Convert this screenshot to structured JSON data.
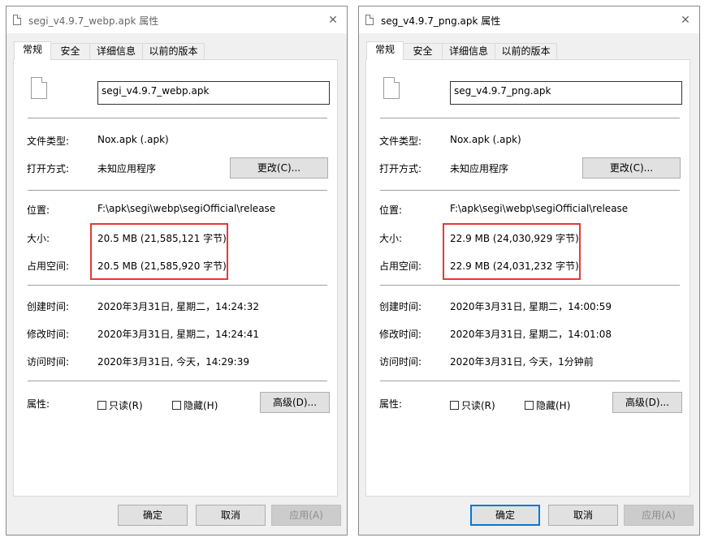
{
  "dialogs": [
    {
      "title": "segi_v4.9.7_webp.apk 属性",
      "tabs": [
        "常规",
        "安全",
        "详细信息",
        "以前的版本"
      ],
      "file_name": "segi_v4.9.7_webp.apk",
      "labels": {
        "type": "文件类型:",
        "opens_with": "打开方式:",
        "location": "位置:",
        "size": "大小:",
        "size_on_disk": "占用空间:",
        "created": "创建时间:",
        "modified": "修改时间:",
        "accessed": "访问时间:",
        "attributes": "属性:"
      },
      "values": {
        "type": "Nox.apk (.apk)",
        "opens_with": "未知应用程序",
        "location": "F:\\apk\\segi\\webp\\segiOfficial\\release",
        "size": "20.5 MB (21,585,121 字节)",
        "size_on_disk": "20.5 MB (21,585,920 字节)",
        "created": "2020年3月31日, 星期二，14:24:32",
        "modified": "2020年3月31日, 星期二，14:24:41",
        "accessed": "2020年3月31日, 今天，14:29:39"
      },
      "change_button": "更改(C)...",
      "readonly": "只读(R)",
      "hidden": "隐藏(H)",
      "advanced_button": "高级(D)...",
      "ok": "确定",
      "cancel": "取消",
      "apply": "应用(A)"
    },
    {
      "title": "seg_v4.9.7_png.apk 属性",
      "tabs": [
        "常规",
        "安全",
        "详细信息",
        "以前的版本"
      ],
      "file_name": "seg_v4.9.7_png.apk",
      "labels": {
        "type": "文件类型:",
        "opens_with": "打开方式:",
        "location": "位置:",
        "size": "大小:",
        "size_on_disk": "占用空间:",
        "created": "创建时间:",
        "modified": "修改时间:",
        "accessed": "访问时间:",
        "attributes": "属性:"
      },
      "values": {
        "type": "Nox.apk (.apk)",
        "opens_with": "未知应用程序",
        "location": "F:\\apk\\segi\\webp\\segiOfficial\\release",
        "size": "22.9 MB (24,030,929 字节)",
        "size_on_disk": "22.9 MB (24,031,232 字节)",
        "created": "2020年3月31日, 星期二，14:00:59",
        "modified": "2020年3月31日, 星期二，14:01:08",
        "accessed": "2020年3月31日, 今天，1分钟前"
      },
      "change_button": "更改(C)...",
      "readonly": "只读(R)",
      "hidden": "隐藏(H)",
      "advanced_button": "高级(D)...",
      "ok": "确定",
      "cancel": "取消",
      "apply": "应用(A)"
    }
  ],
  "colors": {
    "highlight": "#e53935",
    "default_button_border": "#0078d7"
  }
}
